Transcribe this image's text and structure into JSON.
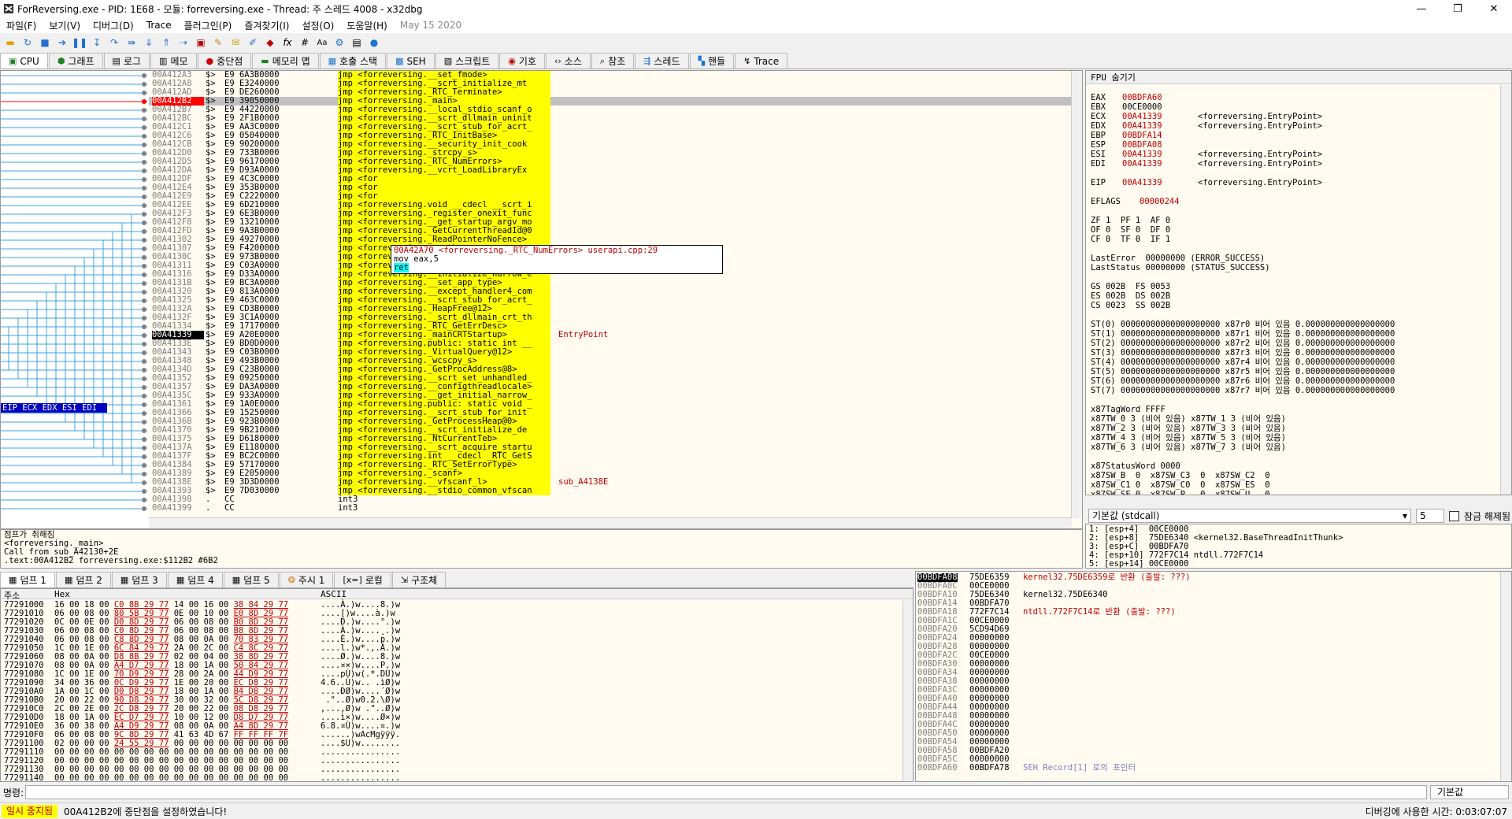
{
  "window": {
    "title": "ForReversing.exe - PID: 1E68 - 모듈: forreversing.exe - Thread: 주 스레드 4008 - x32dbg",
    "min": "—",
    "max": "❐",
    "close": "✕"
  },
  "menu": [
    "파일(F)",
    "보기(V)",
    "디버그(D)",
    "Trace",
    "플러그인(P)",
    "즐겨찾기(I)",
    "설정(O)",
    "도움말(H)",
    "May 15 2020"
  ],
  "toolbar_icons": [
    "open-icon",
    "restart-icon",
    "stop-icon",
    "run-icon",
    "pause-icon",
    "step-into-icon",
    "step-over-icon",
    "trace-into-icon",
    "trace-over-icon",
    "execute-till-return-icon",
    "run-to-user-icon",
    "scylla-icon",
    "patch-icon",
    "comment-icon",
    "label-icon",
    "bookmark-icon",
    "function-icon",
    "hash-icon",
    "font-icon",
    "settings-icon",
    "calculator-icon",
    "help-icon"
  ],
  "main_tabs": [
    "CPU",
    "그래프",
    "로그",
    "메모",
    "중단점",
    "메모리 맵",
    "호출 스택",
    "SEH",
    "스크립트",
    "기호",
    "소스",
    "참조",
    "스레드",
    "핸들",
    "Trace"
  ],
  "disasm": [
    {
      "addr": "00A412A3",
      "mk": "$>",
      "bytes": "E9 6A3B0000",
      "ins": "jmp <forreversing.__set_fmode>"
    },
    {
      "addr": "00A412A8",
      "mk": "$>",
      "bytes": "E9 E3240000",
      "ins": "jmp <forreversing.__scrt_initialize_mt"
    },
    {
      "addr": "00A412AD",
      "mk": "$>",
      "bytes": "E9 DE260000",
      "ins": "jmp <forreversing._RTC_Terminate>"
    },
    {
      "addr": "00A412B2",
      "mk": "$>",
      "bytes": "E9 39050000",
      "ins": "jmp <forreversing._main>",
      "sel": true
    },
    {
      "addr": "00A412B7",
      "mk": "$>",
      "bytes": "E9 44220000",
      "ins": "jmp <forreversing.__local_stdio_scanf_o"
    },
    {
      "addr": "00A412BC",
      "mk": "$>",
      "bytes": "E9 2F1B0000",
      "ins": "jmp <forreversing.__scrt_dllmain_uninit"
    },
    {
      "addr": "00A412C1",
      "mk": "$>",
      "bytes": "E9 AA3C0000",
      "ins": "jmp <forreversing.__scrt_stub_for_acrt_"
    },
    {
      "addr": "00A412C6",
      "mk": "$>",
      "bytes": "E9 05040000",
      "ins": "jmp <forreversing._RTC_InitBase>"
    },
    {
      "addr": "00A412CB",
      "mk": "$>",
      "bytes": "E9 90200000",
      "ins": "jmp <forreversing.__security_init_cook"
    },
    {
      "addr": "00A412D0",
      "mk": "$>",
      "bytes": "E9 733B0000",
      "ins": "jmp <forreversing._strcpy_s>"
    },
    {
      "addr": "00A412D5",
      "mk": "$>",
      "bytes": "E9 96170000",
      "ins": "jmp <forreversing._RTC_NumErrors>"
    },
    {
      "addr": "00A412DA",
      "mk": "$>",
      "bytes": "E9 D93A0000",
      "ins": "jmp <forreversing.__vcrt_LoadLibraryEx"
    },
    {
      "addr": "00A412DF",
      "mk": "$>",
      "bytes": "E9 4C3C0000",
      "ins": "jmp <for"
    },
    {
      "addr": "00A412E4",
      "mk": "$>",
      "bytes": "E9 353B0000",
      "ins": "jmp <for"
    },
    {
      "addr": "00A412E9",
      "mk": "$>",
      "bytes": "E9 C2220000",
      "ins": "jmp <for"
    },
    {
      "addr": "00A412EE",
      "mk": "$>",
      "bytes": "E9 6D210000",
      "ins": "jmp <forreversing.void __cdecl __scrt_i"
    },
    {
      "addr": "00A412F3",
      "mk": "$>",
      "bytes": "E9 6E3B0000",
      "ins": "jmp <forreversing._register_onexit_func"
    },
    {
      "addr": "00A412F8",
      "mk": "$>",
      "bytes": "E9 13210000",
      "ins": "jmp <forreversing.__get_startup_argv_mo"
    },
    {
      "addr": "00A412FD",
      "mk": "$>",
      "bytes": "E9 9A3B0000",
      "ins": "jmp <forreversing._GetCurrentThreadId@0"
    },
    {
      "addr": "00A41302",
      "mk": "$>",
      "bytes": "E9 49270000",
      "ins": "jmp <forreversing._ReadPointerNoFence>"
    },
    {
      "addr": "00A41307",
      "mk": "$>",
      "bytes": "E9 F4200000",
      "ins": "jmp <forreversing.__matherr>"
    },
    {
      "addr": "00A4130C",
      "mk": "$>",
      "bytes": "E9 973B0000",
      "ins": "jmp <forreversing._RaiseException@16>"
    },
    {
      "addr": "00A41311",
      "mk": "$>",
      "bytes": "E9 C03A0000",
      "ins": "jmp <forreversing.__seh_filter_exe>"
    },
    {
      "addr": "00A41316",
      "mk": "$>",
      "bytes": "E9 D33A0000",
      "ins": "jmp <forreversing.__initialize_narrow_e"
    },
    {
      "addr": "00A4131B",
      "mk": "$>",
      "bytes": "E9 BC3A0000",
      "ins": "jmp <forreversing.__set_app_type>"
    },
    {
      "addr": "00A41320",
      "mk": "$>",
      "bytes": "E9 813A0000",
      "ins": "jmp <forreversing.__except_handler4_com"
    },
    {
      "addr": "00A41325",
      "mk": "$>",
      "bytes": "E9 463C0000",
      "ins": "jmp <forreversing.__scrt_stub_for_acrt_"
    },
    {
      "addr": "00A4132A",
      "mk": "$>",
      "bytes": "E9 CD3B0000",
      "ins": "jmp <forreversing._HeapFree@12>"
    },
    {
      "addr": "00A4132F",
      "mk": "$>",
      "bytes": "E9 3C1A0000",
      "ins": "jmp <forreversing.__scrt_dllmain_crt_th"
    },
    {
      "addr": "00A41334",
      "mk": "$>",
      "bytes": "E9 17170000",
      "ins": "jmp <forreversing._RTC_GetErrDesc>"
    },
    {
      "addr": "00A41339",
      "mk": "$>",
      "bytes": "E9 A20E0000",
      "ins": "jmp <forreversing._mainCRTStartup>",
      "eip": true,
      "cmt": "EntryPoint"
    },
    {
      "addr": "00A4133E",
      "mk": "$>",
      "bytes": "E9 BD0D0000",
      "ins": "jmp <forreversing.public: static int __"
    },
    {
      "addr": "00A41343",
      "mk": "$>",
      "bytes": "E9 C03B0000",
      "ins": "jmp <forreversing._VirtualQuery@12>"
    },
    {
      "addr": "00A41348",
      "mk": "$>",
      "bytes": "E9 493B0000",
      "ins": "jmp <forreversing._wcscpy_s>"
    },
    {
      "addr": "00A4134D",
      "mk": "$>",
      "bytes": "E9 C23B0000",
      "ins": "jmp <forreversing._GetProcAddress@8>"
    },
    {
      "addr": "00A41352",
      "mk": "$>",
      "bytes": "E9 09250000",
      "ins": "jmp <forreversing.__scrt_set_unhandled_"
    },
    {
      "addr": "00A41357",
      "mk": "$>",
      "bytes": "E9 DA3A0000",
      "ins": "jmp <forreversing.__configthreadlocale>"
    },
    {
      "addr": "00A4135C",
      "mk": "$>",
      "bytes": "E9 933A0000",
      "ins": "jmp <forreversing.__get_initial_narrow_"
    },
    {
      "addr": "00A41361",
      "mk": "$>",
      "bytes": "E9 1A0E0000",
      "ins": "jmp <forreversing.public: static void _"
    },
    {
      "addr": "00A41366",
      "mk": "$>",
      "bytes": "E9 15250000",
      "ins": "jmp <forreversing.__scrt_stub_for_init"
    },
    {
      "addr": "00A4136B",
      "mk": "$>",
      "bytes": "E9 923B0000",
      "ins": "jmp <forreversing._GetProcessHeap@0>"
    },
    {
      "addr": "00A41370",
      "mk": "$>",
      "bytes": "E9 9B210000",
      "ins": "jmp <forreversing.__scrt_initialize_de"
    },
    {
      "addr": "00A41375",
      "mk": "$>",
      "bytes": "E9 D6180000",
      "ins": "jmp <forreversing._NtCurrentTeb>"
    },
    {
      "addr": "00A4137A",
      "mk": "$>",
      "bytes": "E9 E1180000",
      "ins": "jmp <forreversing.__scrt_acquire_startu"
    },
    {
      "addr": "00A4137F",
      "mk": "$>",
      "bytes": "E9 BC2C0000",
      "ins": "jmp <forreversing.int __cdecl _RTC_GetS"
    },
    {
      "addr": "00A41384",
      "mk": "$>",
      "bytes": "E9 57170000",
      "ins": "jmp <forreversing._RTC_SetErrorType>"
    },
    {
      "addr": "00A41389",
      "mk": "$>",
      "bytes": "E9 E2050000",
      "ins": "jmp <forreversing._scanf>"
    },
    {
      "addr": "00A4138E",
      "mk": "$>",
      "bytes": "E9 3D3D0000",
      "ins": "jmp <forreversing.__vfscanf_l>",
      "cmt": "sub_A4138E"
    },
    {
      "addr": "00A41393",
      "mk": "$>",
      "bytes": "E9 7D030000",
      "ins": "jmp <forreversing.__stdio_common_vfscan"
    },
    {
      "addr": "00A41398",
      "mk": ".",
      "bytes": "CC",
      "ins": "int3",
      "plain": true
    },
    {
      "addr": "00A41399",
      "mk": ".",
      "bytes": "CC",
      "ins": "int3",
      "plain": true
    }
  ],
  "tooltip": {
    "line1": "00A42A70 <forreversing._RTC_NumErrors> userapi.cpp:29",
    "line2": "mov eax,5",
    "line3": "ret"
  },
  "eip_label": "EIP ECX EDX ESI EDI",
  "info": "점프가 취해짐\n<forreversing._main>\nCall from sub_A42130+2E\n.text:00A412B2 forreversing.exe:$112B2 #6B2",
  "registers": {
    "header": "FPU 숨기기",
    "body": [
      {
        "k": "EAX",
        "v": "00BDFA60",
        "c": ""
      },
      {
        "k": "EBX",
        "v": "00CE0000",
        "c": "",
        "black": true
      },
      {
        "k": "ECX",
        "v": "00A41339",
        "c": "<forreversing.EntryPoint>"
      },
      {
        "k": "EDX",
        "v": "00A41339",
        "c": "<forreversing.EntryPoint>"
      },
      {
        "k": "EBP",
        "v": "00BDFA14",
        "c": ""
      },
      {
        "k": "ESP",
        "v": "00BDFA08",
        "c": ""
      },
      {
        "k": "ESI",
        "v": "00A41339",
        "c": "<forreversing.EntryPoint>"
      },
      {
        "k": "EDI",
        "v": "00A41339",
        "c": "<forreversing.EntryPoint>"
      },
      {
        "k": "",
        "v": "",
        "c": ""
      },
      {
        "k": "EIP",
        "v": "00A41339",
        "c": "<forreversing.EntryPoint>"
      },
      {
        "k": "",
        "v": "",
        "c": ""
      },
      {
        "k": "EFLAGS",
        "v": "00000244",
        "c": ""
      }
    ],
    "flags": [
      "ZF 1  PF 1  AF 0",
      "OF 0  SF 0  DF 0",
      "CF 0  TF 0  IF 1"
    ],
    "errors": [
      "LastError  00000000 (ERROR_SUCCESS)",
      "LastStatus 00000000 (STATUS_SUCCESS)"
    ],
    "segs": [
      "GS 002B  FS 0053",
      "ES 002B  DS 002B",
      "CS 0023  SS 002B"
    ],
    "st": [
      "ST(0) 00000000000000000000 x87r0 비어 있음 0.000000000000000000",
      "ST(1) 00000000000000000000 x87r1 비어 있음 0.000000000000000000",
      "ST(2) 00000000000000000000 x87r2 비어 있음 0.000000000000000000",
      "ST(3) 00000000000000000000 x87r3 비어 있음 0.000000000000000000",
      "ST(4) 00000000000000000000 x87r4 비어 있음 0.000000000000000000",
      "ST(5) 00000000000000000000 x87r5 비어 있음 0.000000000000000000",
      "ST(6) 00000000000000000000 x87r6 비어 있음 0.000000000000000000",
      "ST(7) 00000000000000000000 x87r7 비어 있음 0.000000000000000000"
    ],
    "tag": [
      "x87TagWord FFFF",
      "x87TW_0 3 (비어 있음) x87TW_1 3 (비어 있음)",
      "x87TW_2 3 (비어 있음) x87TW_3 3 (비어 있음)",
      "x87TW_4 3 (비어 있음) x87TW_5 3 (비어 있음)",
      "x87TW_6 3 (비어 있음) x87TW_7 3 (비어 있음)"
    ],
    "status": [
      "x87StatusWord 0000",
      "x87SW_B  0  x87SW_C3  0  x87SW_C2  0",
      "x87SW_C1 0  x87SW_C0  0  x87SW_ES  0",
      "x87SW_SF 0  x87SW_P   0  x87SW_U   0",
      "x87SW_O  0  x87SW_Z   0  x87SW_D   0"
    ]
  },
  "callconv": {
    "label": "기본값 (stdcall)",
    "num": "5",
    "lock": "잠금 해제됨"
  },
  "args": "1: [esp+4]  00CE0000\n2: [esp+8]  75DE6340 <kernel32.BaseThreadInitThunk>\n3: [esp+C]  00BDFA70\n4: [esp+10] 772F7C14 ntdll.772F7C14\n5: [esp+14] 00CE0000",
  "dump_tabs": [
    "덤프 1",
    "덤프 2",
    "덤프 3",
    "덤프 4",
    "덤프 5",
    "주시 1",
    "로컬",
    "구조체"
  ],
  "dump_header": {
    "addr": "주소",
    "hex": "Hex",
    "ascii": "ASCII"
  },
  "dump": [
    {
      "a": "77291000",
      "h": "16 00 18 00 ",
      "u": "C0 8B 29 77",
      "h2": " 14 00 16 00 ",
      "u2": "38 84 29 77",
      "s": "....À.)w....8.)w"
    },
    {
      "a": "77291010",
      "h": "06 00 08 00 ",
      "u": "80 5B 29 77",
      "h2": " 0E 00 10 00 ",
      "u2": "E0 8D 29 77",
      "s": "....[)w....à.)w"
    },
    {
      "a": "77291020",
      "h": "0C 00 0E 00 ",
      "u": "D0 8D 29 77",
      "h2": " 06 00 08 00 ",
      "u2": "B0 8D 29 77",
      "s": "....Ð.)w....°.)w"
    },
    {
      "a": "77291030",
      "h": "06 00 08 00 ",
      "u": "C0 8D 29 77",
      "h2": " 06 00 08 00 ",
      "u2": "B8 8D 29 77",
      "s": "....À.)w....¸.)w"
    },
    {
      "a": "77291040",
      "h": "06 00 08 00 ",
      "u": "C8 8D 29 77",
      "h2": " 08 00 0A 00 ",
      "u2": "70 83 29 77",
      "s": "....È.)w....p.)w"
    },
    {
      "a": "77291050",
      "h": "1C 00 1E 00 ",
      "u": "6C 84 29 77",
      "h2": " 2A 00 2C 00 ",
      "u2": "C4 8C 29 77",
      "s": "....l.)w*.,.Ä.)w"
    },
    {
      "a": "77291060",
      "h": "08 00 0A 00 ",
      "u": "D8 8B 29 77",
      "h2": " 02 00 04 00 ",
      "u2": "38 8D 29 77",
      "s": "....Ø.)w....8.)w"
    },
    {
      "a": "77291070",
      "h": "08 00 0A 00 ",
      "u": "A4 D7 29 77",
      "h2": " 18 00 1A 00 ",
      "u2": "50 84 29 77",
      "s": "....¤×)w....P.)w"
    },
    {
      "a": "77291080",
      "h": "1C 00 1E 00 ",
      "u": "70 D9 29 77",
      "h2": " 28 00 2A 00 ",
      "u2": "44 D9 29 77",
      "s": "....pÙ)w(.*.DÙ)w"
    },
    {
      "a": "77291090",
      "h": "34 00 36 00 ",
      "u": "0C D9 29 77",
      "h2": " 1E 00 20 00 ",
      "u2": "EC D8 29 77",
      "s": "4.6..Ù)w.. .ìØ)w"
    },
    {
      "a": "772910A0",
      "h": "1A 00 1C 00 ",
      "u": "D0 D8 29 77",
      "h2": " 18 00 1A 00 ",
      "u2": "B4 D8 29 77",
      "s": "....ÐØ)w....´Ø)w"
    },
    {
      "a": "772910B0",
      "h": "20 00 22 00 ",
      "u": "90 D8 29 77",
      "h2": " 30 00 32 00 ",
      "u2": "5C D8 29 77",
      "s": " .\"..Ø)w0.2.\\Ø)w"
    },
    {
      "a": "772910C0",
      "h": "2C 00 2E 00 ",
      "u": "2C D8 29 77",
      "h2": " 20 00 22 00 ",
      "u2": "08 D8 29 77",
      "s": ",...,Ø)w .\"..Ø)w"
    },
    {
      "a": "772910D0",
      "h": "18 00 1A 00 ",
      "u": "EC D7 29 77",
      "h2": " 10 00 12 00 ",
      "u2": "D8 D7 29 77",
      "s": "....ì×)w....Ø×)w"
    },
    {
      "a": "772910E0",
      "h": "36 00 38 00 ",
      "u": "A4 D9 29 77",
      "h2": " 08 00 0A 00 ",
      "u2": "A4 8D 29 77",
      "s": "6.8.¤Ù)w....¤.)w"
    },
    {
      "a": "772910F0",
      "h": "06 00 08 00 ",
      "u": "9C 8D 29 77",
      "h2": " 41 63 4D 67 ",
      "u2": "FF FF FF 7F",
      "s": "......)wAcMgÿÿÿ."
    },
    {
      "a": "77291100",
      "h": "02 00 00 00 ",
      "u": "24 55 29 77",
      "h2": " 00 00 00 00 00 00 00 00",
      "u2": "",
      "s": "....$U)w........"
    },
    {
      "a": "77291110",
      "h": "00 00 00 00 00 00 00 00 00 00 00 00 00 00 00 00",
      "u": "",
      "h2": "",
      "u2": "",
      "s": "................"
    },
    {
      "a": "77291120",
      "h": "00 00 00 00 00 00 00 00 00 00 00 00 00 00 00 00",
      "u": "",
      "h2": "",
      "u2": "",
      "s": "................"
    },
    {
      "a": "77291130",
      "h": "00 00 00 00 00 00 00 00 00 00 00 00 00 00 00 00",
      "u": "",
      "h2": "",
      "u2": "",
      "s": "................"
    },
    {
      "a": "77291140",
      "h": "00 00 00 00 00 00 00 00 00 00 00 00 00 00 00 00",
      "u": "",
      "h2": "",
      "u2": "",
      "s": "................"
    }
  ],
  "stack": [
    {
      "a": "00BDFA08",
      "v": "75DE6359",
      "c": "kernel32.75DE6359로 반환 (출발: ???)",
      "red": true,
      "top": true
    },
    {
      "a": "00BDFA0C",
      "v": "00CE0000",
      "c": ""
    },
    {
      "a": "00BDFA10",
      "v": "75DE6340",
      "c": "kernel32.75DE6340"
    },
    {
      "a": "00BDFA14",
      "v": "00BDFA70",
      "c": ""
    },
    {
      "a": "00BDFA18",
      "v": "772F7C14",
      "c": "ntdll.772F7C14로 반환 (출발: ???)",
      "red": true
    },
    {
      "a": "00BDFA1C",
      "v": "00CE0000",
      "c": ""
    },
    {
      "a": "00BDFA20",
      "v": "5CD94D69",
      "c": ""
    },
    {
      "a": "00BDFA24",
      "v": "00000000",
      "c": ""
    },
    {
      "a": "00BDFA28",
      "v": "00000000",
      "c": ""
    },
    {
      "a": "00BDFA2C",
      "v": "00CE0000",
      "c": ""
    },
    {
      "a": "00BDFA30",
      "v": "00000000",
      "c": ""
    },
    {
      "a": "00BDFA34",
      "v": "00000000",
      "c": ""
    },
    {
      "a": "00BDFA38",
      "v": "00000000",
      "c": ""
    },
    {
      "a": "00BDFA3C",
      "v": "00000000",
      "c": ""
    },
    {
      "a": "00BDFA40",
      "v": "00000000",
      "c": ""
    },
    {
      "a": "00BDFA44",
      "v": "00000000",
      "c": ""
    },
    {
      "a": "00BDFA48",
      "v": "00000000",
      "c": ""
    },
    {
      "a": "00BDFA4C",
      "v": "00000000",
      "c": ""
    },
    {
      "a": "00BDFA50",
      "v": "00000000",
      "c": ""
    },
    {
      "a": "00BDFA54",
      "v": "00000000",
      "c": ""
    },
    {
      "a": "00BDFA58",
      "v": "00BDFA20",
      "c": ""
    },
    {
      "a": "00BDFA5C",
      "v": "00000000",
      "c": ""
    },
    {
      "a": "00BDFA60",
      "v": "00BDFA78",
      "c": "SEH Record[1] 로의 포인터",
      "blue": true
    }
  ],
  "command": {
    "label": "명령:",
    "default": "기본값"
  },
  "status": {
    "state": "일시 중지됨",
    "message": "00A412B2에 중단점을 설정하였습니다!",
    "time": "디버깅에 사용한 시간: 0:03:07:07"
  }
}
